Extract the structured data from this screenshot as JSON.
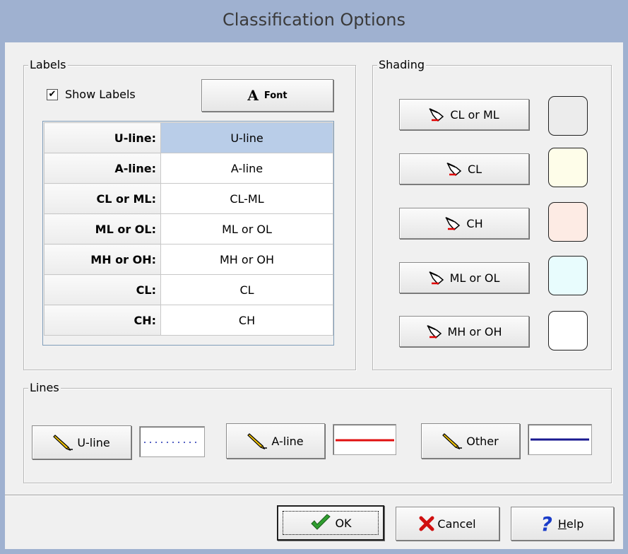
{
  "window": {
    "title": "Classification Options"
  },
  "labels": {
    "group_title": "Labels",
    "show_labels": {
      "text": "Show Labels",
      "checked": true
    },
    "font_button": "Font",
    "rows": [
      {
        "key": "U-line:",
        "value": "U-line"
      },
      {
        "key": "A-line:",
        "value": "A-line"
      },
      {
        "key": "CL or ML:",
        "value": "CL-ML"
      },
      {
        "key": "ML or OL:",
        "value": "ML or OL"
      },
      {
        "key": "MH or OH:",
        "value": "MH or OH"
      },
      {
        "key": "CL:",
        "value": "CL"
      },
      {
        "key": "CH:",
        "value": "CH"
      }
    ]
  },
  "shading": {
    "group_title": "Shading",
    "items": [
      {
        "label": "CL or ML",
        "color": "#ececec"
      },
      {
        "label": "CL",
        "color": "#fefde9"
      },
      {
        "label": "CH",
        "color": "#fdebe4"
      },
      {
        "label": "ML or OL",
        "color": "#e8fcfd"
      },
      {
        "label": "MH or OH",
        "color": "#ffffff"
      }
    ]
  },
  "lines": {
    "group_title": "Lines",
    "items": [
      {
        "label": "U-line",
        "style": "dotted",
        "color": "#1f2fb0"
      },
      {
        "label": "A-line",
        "style": "solid",
        "color": "#e01010"
      },
      {
        "label": "Other",
        "style": "solid",
        "color": "#1a1a90"
      }
    ]
  },
  "footer": {
    "ok": "OK",
    "cancel": "Cancel",
    "help_underlined": "H",
    "help_rest": "elp"
  }
}
